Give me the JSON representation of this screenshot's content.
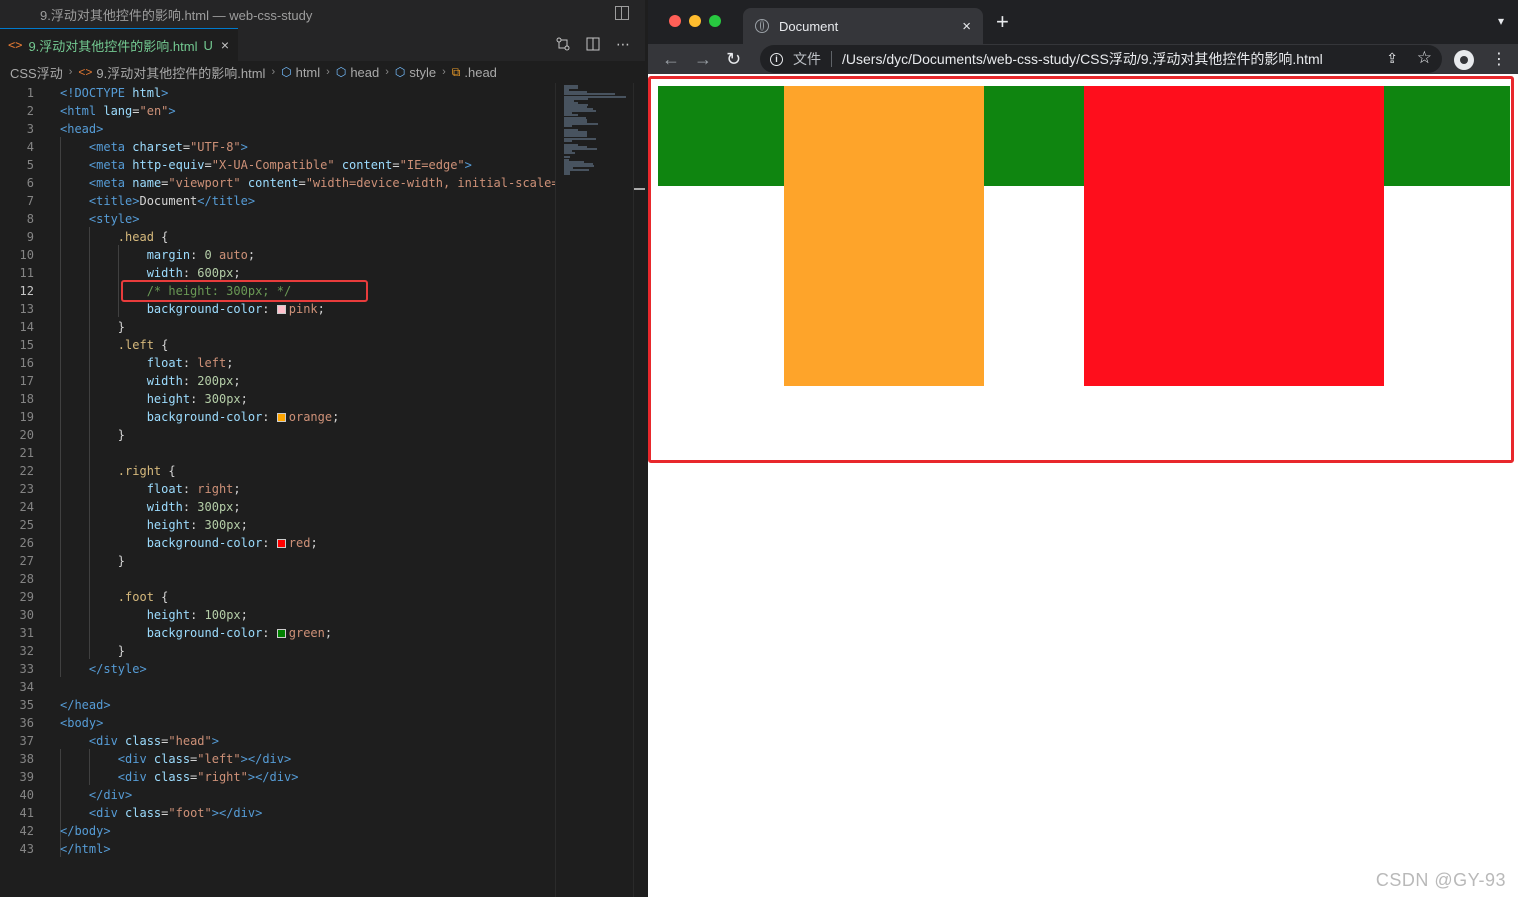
{
  "vscode": {
    "window_title": "9.浮动对其他控件的影响.html — web-css-study",
    "tab": {
      "label": "9.浮动对其他控件的影响.html",
      "modified": "U",
      "close": "×"
    },
    "breadcrumb": [
      "CSS浮动",
      "9.浮动对其他控件的影响.html",
      "html",
      "head",
      "style",
      ".head"
    ],
    "active_line": 12,
    "code": [
      [
        {
          "c": "t",
          "v": "<!DOCTYPE "
        },
        {
          "c": "a",
          "v": "html"
        },
        {
          "c": "t",
          "v": ">"
        }
      ],
      [
        {
          "c": "t",
          "v": "<html "
        },
        {
          "c": "a",
          "v": "lang"
        },
        {
          "c": "",
          "v": "="
        },
        {
          "c": "s",
          "v": "\"en\""
        },
        {
          "c": "t",
          "v": ">"
        }
      ],
      [
        {
          "c": "t",
          "v": "<head>"
        }
      ],
      [
        {
          "c": "",
          "v": "    "
        },
        {
          "c": "t",
          "v": "<meta "
        },
        {
          "c": "a",
          "v": "charset"
        },
        {
          "c": "",
          "v": "="
        },
        {
          "c": "s",
          "v": "\"UTF-8\""
        },
        {
          "c": "t",
          "v": ">"
        }
      ],
      [
        {
          "c": "",
          "v": "    "
        },
        {
          "c": "t",
          "v": "<meta "
        },
        {
          "c": "a",
          "v": "http-equiv"
        },
        {
          "c": "",
          "v": "="
        },
        {
          "c": "s",
          "v": "\"X-UA-Compatible\""
        },
        {
          "c": "",
          "v": " "
        },
        {
          "c": "a",
          "v": "content"
        },
        {
          "c": "",
          "v": "="
        },
        {
          "c": "s",
          "v": "\"IE=edge\""
        },
        {
          "c": "t",
          "v": ">"
        }
      ],
      [
        {
          "c": "",
          "v": "    "
        },
        {
          "c": "t",
          "v": "<meta "
        },
        {
          "c": "a",
          "v": "name"
        },
        {
          "c": "",
          "v": "="
        },
        {
          "c": "s",
          "v": "\"viewport\""
        },
        {
          "c": "",
          "v": " "
        },
        {
          "c": "a",
          "v": "content"
        },
        {
          "c": "",
          "v": "="
        },
        {
          "c": "s",
          "v": "\"width=device-width, initial-scale="
        }
      ],
      [
        {
          "c": "",
          "v": "    "
        },
        {
          "c": "t",
          "v": "<title>"
        },
        {
          "c": "",
          "v": "Document"
        },
        {
          "c": "t",
          "v": "</title>"
        }
      ],
      [
        {
          "c": "",
          "v": "    "
        },
        {
          "c": "t",
          "v": "<style>"
        }
      ],
      [
        {
          "c": "",
          "v": "        "
        },
        {
          "c": "sel",
          "v": ".head"
        },
        {
          "c": "",
          "v": " {"
        }
      ],
      [
        {
          "c": "",
          "v": "            "
        },
        {
          "c": "p",
          "v": "margin"
        },
        {
          "c": "",
          "v": ": "
        },
        {
          "c": "n",
          "v": "0"
        },
        {
          "c": "",
          "v": " "
        },
        {
          "c": "s",
          "v": "auto"
        },
        {
          "c": "",
          "v": ";"
        }
      ],
      [
        {
          "c": "",
          "v": "            "
        },
        {
          "c": "p",
          "v": "width"
        },
        {
          "c": "",
          "v": ": "
        },
        {
          "c": "n",
          "v": "600px"
        },
        {
          "c": "",
          "v": ";"
        }
      ],
      [
        {
          "c": "",
          "v": "            "
        },
        {
          "c": "c",
          "v": "/* height: 300px; */"
        }
      ],
      [
        {
          "c": "",
          "v": "            "
        },
        {
          "c": "p",
          "v": "background-color"
        },
        {
          "c": "",
          "v": ": "
        },
        {
          "c": "sw",
          "v": "#ffc0cb"
        },
        {
          "c": "s",
          "v": "pink"
        },
        {
          "c": "",
          "v": ";"
        }
      ],
      [
        {
          "c": "",
          "v": "        }"
        }
      ],
      [
        {
          "c": "",
          "v": "        "
        },
        {
          "c": "sel",
          "v": ".left"
        },
        {
          "c": "",
          "v": " {"
        }
      ],
      [
        {
          "c": "",
          "v": "            "
        },
        {
          "c": "p",
          "v": "float"
        },
        {
          "c": "",
          "v": ": "
        },
        {
          "c": "s",
          "v": "left"
        },
        {
          "c": "",
          "v": ";"
        }
      ],
      [
        {
          "c": "",
          "v": "            "
        },
        {
          "c": "p",
          "v": "width"
        },
        {
          "c": "",
          "v": ": "
        },
        {
          "c": "n",
          "v": "200px"
        },
        {
          "c": "",
          "v": ";"
        }
      ],
      [
        {
          "c": "",
          "v": "            "
        },
        {
          "c": "p",
          "v": "height"
        },
        {
          "c": "",
          "v": ": "
        },
        {
          "c": "n",
          "v": "300px"
        },
        {
          "c": "",
          "v": ";"
        }
      ],
      [
        {
          "c": "",
          "v": "            "
        },
        {
          "c": "p",
          "v": "background-color"
        },
        {
          "c": "",
          "v": ": "
        },
        {
          "c": "sw",
          "v": "#ffa500"
        },
        {
          "c": "s",
          "v": "orange"
        },
        {
          "c": "",
          "v": ";"
        }
      ],
      [
        {
          "c": "",
          "v": "        }"
        }
      ],
      [],
      [
        {
          "c": "",
          "v": "        "
        },
        {
          "c": "sel",
          "v": ".right"
        },
        {
          "c": "",
          "v": " {"
        }
      ],
      [
        {
          "c": "",
          "v": "            "
        },
        {
          "c": "p",
          "v": "float"
        },
        {
          "c": "",
          "v": ": "
        },
        {
          "c": "s",
          "v": "right"
        },
        {
          "c": "",
          "v": ";"
        }
      ],
      [
        {
          "c": "",
          "v": "            "
        },
        {
          "c": "p",
          "v": "width"
        },
        {
          "c": "",
          "v": ": "
        },
        {
          "c": "n",
          "v": "300px"
        },
        {
          "c": "",
          "v": ";"
        }
      ],
      [
        {
          "c": "",
          "v": "            "
        },
        {
          "c": "p",
          "v": "height"
        },
        {
          "c": "",
          "v": ": "
        },
        {
          "c": "n",
          "v": "300px"
        },
        {
          "c": "",
          "v": ";"
        }
      ],
      [
        {
          "c": "",
          "v": "            "
        },
        {
          "c": "p",
          "v": "background-color"
        },
        {
          "c": "",
          "v": ": "
        },
        {
          "c": "sw",
          "v": "#ff0000"
        },
        {
          "c": "s",
          "v": "red"
        },
        {
          "c": "",
          "v": ";"
        }
      ],
      [
        {
          "c": "",
          "v": "        }"
        }
      ],
      [],
      [
        {
          "c": "",
          "v": "        "
        },
        {
          "c": "sel",
          "v": ".foot"
        },
        {
          "c": "",
          "v": " {"
        }
      ],
      [
        {
          "c": "",
          "v": "            "
        },
        {
          "c": "p",
          "v": "height"
        },
        {
          "c": "",
          "v": ": "
        },
        {
          "c": "n",
          "v": "100px"
        },
        {
          "c": "",
          "v": ";"
        }
      ],
      [
        {
          "c": "",
          "v": "            "
        },
        {
          "c": "p",
          "v": "background-color"
        },
        {
          "c": "",
          "v": ": "
        },
        {
          "c": "sw",
          "v": "#008000"
        },
        {
          "c": "s",
          "v": "green"
        },
        {
          "c": "",
          "v": ";"
        }
      ],
      [
        {
          "c": "",
          "v": "        }"
        }
      ],
      [
        {
          "c": "",
          "v": "    "
        },
        {
          "c": "t",
          "v": "</style>"
        }
      ],
      [],
      [
        {
          "c": "t",
          "v": "</head>"
        }
      ],
      [
        {
          "c": "t",
          "v": "<body>"
        }
      ],
      [
        {
          "c": "",
          "v": "    "
        },
        {
          "c": "t",
          "v": "<div "
        },
        {
          "c": "a",
          "v": "class"
        },
        {
          "c": "",
          "v": "="
        },
        {
          "c": "s",
          "v": "\"head\""
        },
        {
          "c": "t",
          "v": ">"
        }
      ],
      [
        {
          "c": "",
          "v": "        "
        },
        {
          "c": "t",
          "v": "<div "
        },
        {
          "c": "a",
          "v": "class"
        },
        {
          "c": "",
          "v": "="
        },
        {
          "c": "s",
          "v": "\"left\""
        },
        {
          "c": "t",
          "v": "></div>"
        }
      ],
      [
        {
          "c": "",
          "v": "        "
        },
        {
          "c": "t",
          "v": "<div "
        },
        {
          "c": "a",
          "v": "class"
        },
        {
          "c": "",
          "v": "="
        },
        {
          "c": "s",
          "v": "\"right\""
        },
        {
          "c": "t",
          "v": "></div>"
        }
      ],
      [
        {
          "c": "",
          "v": "    "
        },
        {
          "c": "t",
          "v": "</div>"
        }
      ],
      [
        {
          "c": "",
          "v": "    "
        },
        {
          "c": "t",
          "v": "<div "
        },
        {
          "c": "a",
          "v": "class"
        },
        {
          "c": "",
          "v": "="
        },
        {
          "c": "s",
          "v": "\"foot\""
        },
        {
          "c": "t",
          "v": "></div>"
        }
      ],
      [
        {
          "c": "t",
          "v": "</body>"
        }
      ],
      [
        {
          "c": "t",
          "v": "</html>"
        }
      ]
    ]
  },
  "browser": {
    "tab_title": "Document",
    "tab_close": "×",
    "new_tab": "+",
    "address_scheme_label": "文件",
    "url": "/Users/dyc/Documents/web-css-study/CSS浮动/9.浮动对其他控件的影响.html",
    "colors": {
      "foot": "#0f8510",
      "left": "#fea42a",
      "right": "#fe0e1c",
      "highlight": "#e8282c"
    },
    "watermark": "CSDN @GY-93"
  }
}
